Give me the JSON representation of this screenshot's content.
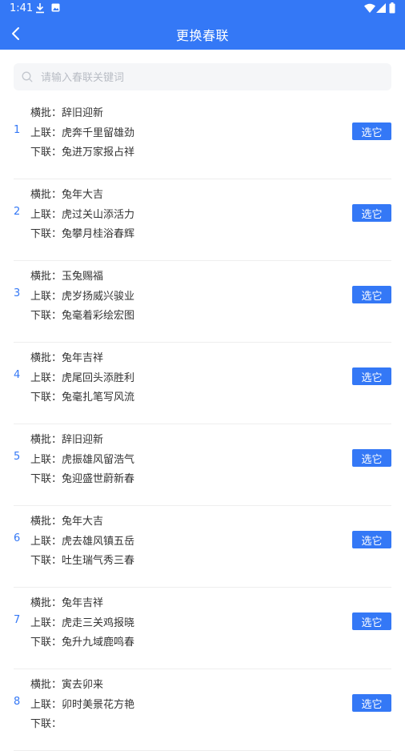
{
  "status": {
    "time": "1:41"
  },
  "nav": {
    "title": "更换春联"
  },
  "search": {
    "placeholder": "请输入春联关键词"
  },
  "labels": {
    "horizontal": "横批：",
    "upper": "上联：",
    "lower": "下联：",
    "pick": "选它"
  },
  "couplets": [
    {
      "num": "1",
      "horizontal": "辞旧迎新",
      "upper": "虎奔千里留雄劲",
      "lower": "兔进万家报占祥"
    },
    {
      "num": "2",
      "horizontal": "兔年大吉",
      "upper": "虎过关山添活力",
      "lower": "兔攀月桂浴春辉"
    },
    {
      "num": "3",
      "horizontal": "玉兔赐福",
      "upper": "虎岁扬威兴骏业",
      "lower": "兔毫着彩绘宏图"
    },
    {
      "num": "4",
      "horizontal": "兔年吉祥",
      "upper": "虎尾回头添胜利",
      "lower": "兔毫扎笔写风流"
    },
    {
      "num": "5",
      "horizontal": "辞旧迎新",
      "upper": "虎振雄风留浩气",
      "lower": "兔迎盛世蔚新春"
    },
    {
      "num": "6",
      "horizontal": "兔年大吉",
      "upper": "虎去雄风镇五岳",
      "lower": "吐生瑞气秀三春"
    },
    {
      "num": "7",
      "horizontal": "兔年吉祥",
      "upper": "虎走三关鸡报晓",
      "lower": "兔升九域鹿鸣春"
    },
    {
      "num": "8",
      "horizontal": "寅去卯来",
      "upper": "卯时美景花方艳",
      "lower": ""
    }
  ]
}
